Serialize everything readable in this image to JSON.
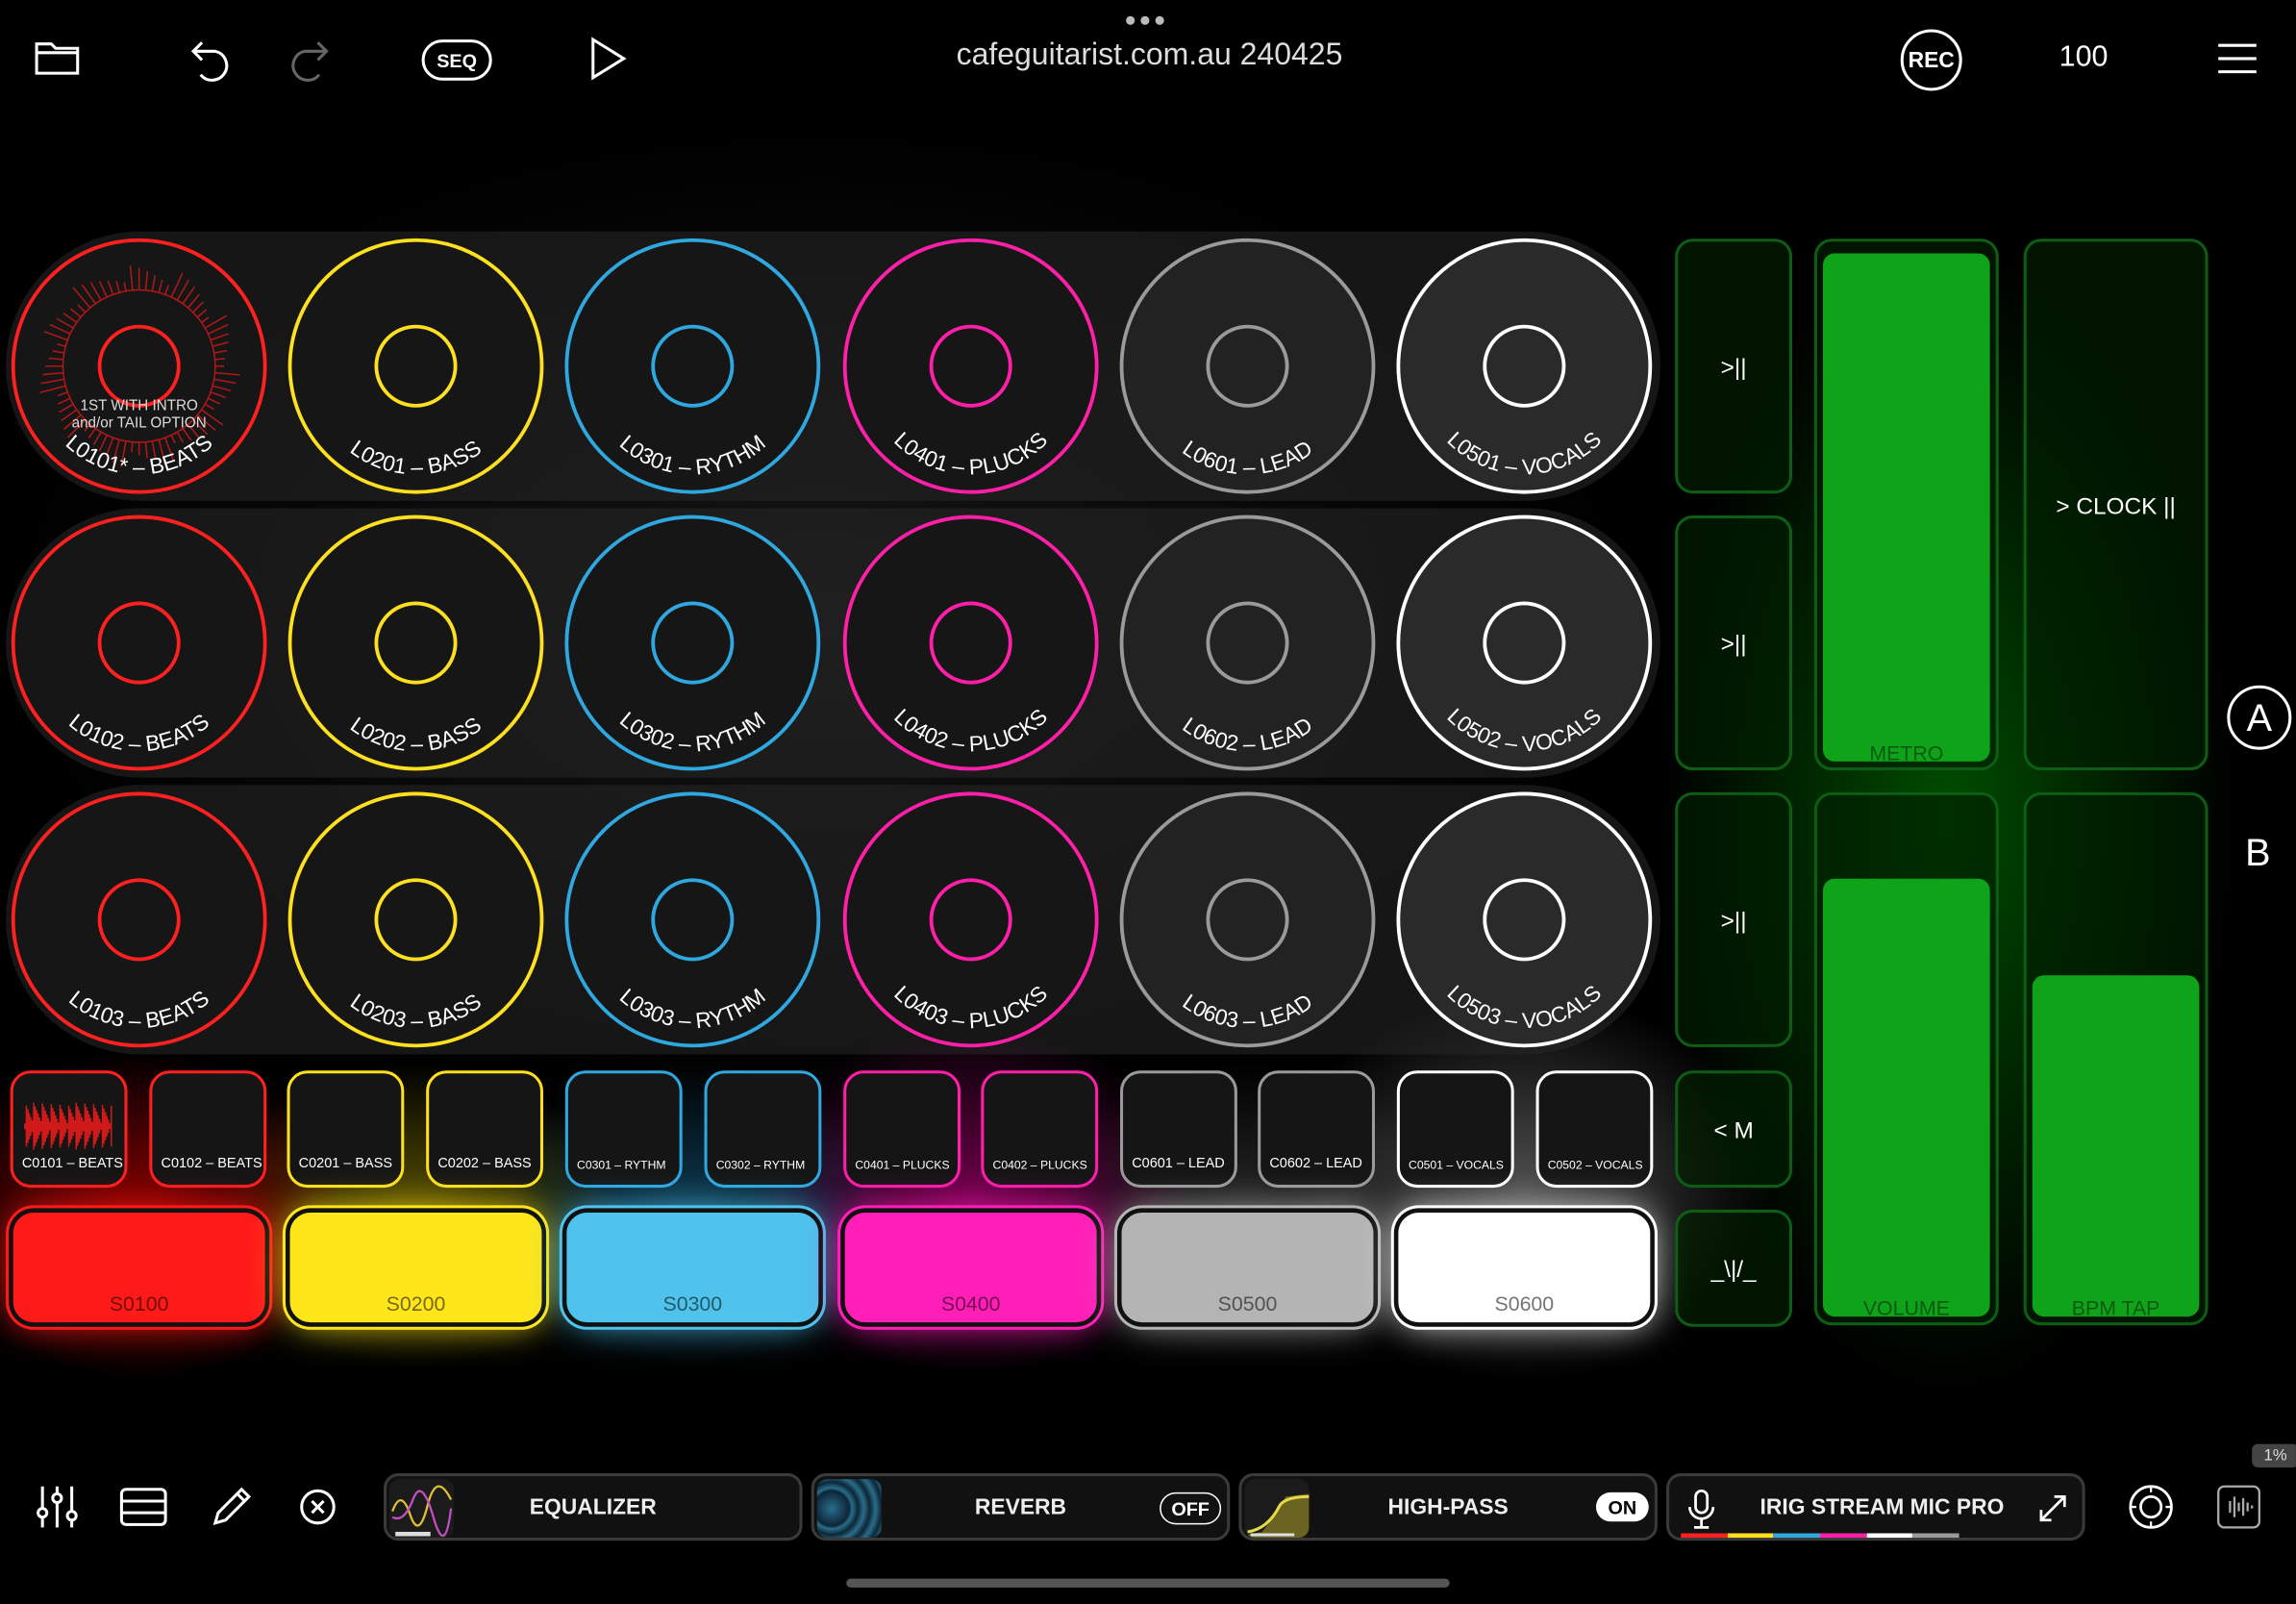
{
  "header": {
    "title": "cafeguitarist.com.au 240425",
    "seq_label": "SEQ",
    "rec_label": "REC",
    "bpm": "100",
    "icons": [
      "folder-icon",
      "undo-icon",
      "redo-icon",
      "play-icon",
      "menu-icon",
      "more-dots-icon"
    ]
  },
  "pads": {
    "row1": [
      "L0101* – BEATS",
      "L0201 – BASS",
      "L0301 – RYTHM",
      "L0401 – PLUCKS",
      "L0601 – LEAD",
      "L0501 – VOCALS"
    ],
    "row2": [
      "L0102 – BEATS",
      "L0202 – BASS",
      "L0302 – RYTHM",
      "L0402 – PLUCKS",
      "L0602 – LEAD",
      "L0502 – VOCALS"
    ],
    "row3": [
      "L0103 – BEATS",
      "L0203 – BASS",
      "L0303 – RYTHM",
      "L0403 – PLUCKS",
      "L0603 – LEAD",
      "L0503 – VOCALS"
    ],
    "first_pad_note_line1": "1ST WITH INTRO",
    "first_pad_note_line2": "and/or TAIL OPTION",
    "colors": [
      "#ff2020",
      "#ffe020",
      "#2fa8e0",
      "#ff1fa8",
      "#9a9a9a",
      "#ffffff"
    ]
  },
  "clips": [
    "C0101 – BEATS",
    "C0102 – BEATS",
    "C0201 – BASS",
    "C0202 – BASS",
    "C0301 – RYTHM",
    "C0302 – RYTHM",
    "C0401 – PLUCKS",
    "C0402 – PLUCKS",
    "C0601 – LEAD",
    "C0602 – LEAD",
    "C0501 – VOCALS",
    "C0502 – VOCALS"
  ],
  "scenes": [
    {
      "label": "S0100",
      "color": "#ff1a1a"
    },
    {
      "label": "S0200",
      "color": "#ffe61a"
    },
    {
      "label": "S0300",
      "color": "#4fc3ec"
    },
    {
      "label": "S0400",
      "color": "#ff1fb8"
    },
    {
      "label": "S0500",
      "color": "#b4b4b4"
    },
    {
      "label": "S0600",
      "color": "#ffffff"
    }
  ],
  "controls": {
    "play_pause_1": ">||",
    "play_pause_2": ">||",
    "play_pause_3": ">||",
    "marker": "< M",
    "tune": "_\\|/_",
    "metro_label": "METRO",
    "metro_level": 1.0,
    "clock_label": "> CLOCK ||",
    "volume_label": "VOLUME",
    "volume_level": 0.86,
    "bpm_tap_label": "BPM TAP",
    "bpm_tap_level": 0.67,
    "bank_a": "A",
    "bank_b": "B",
    "accent_green": "#0fa31a"
  },
  "bottom": {
    "equalizer_label": "EQUALIZER",
    "reverb_label": "REVERB",
    "reverb_state": "OFF",
    "highpass_label": "HIGH-PASS",
    "highpass_state": "ON",
    "input_label": "IRIG STREAM MIC PRO",
    "percent": "1%",
    "icons": [
      "mixer-sliders-icon",
      "list-icon",
      "pencil-icon",
      "close-circle-icon",
      "microphone-icon",
      "expand-icon",
      "settings-dial-icon",
      "waveform-icon"
    ]
  }
}
